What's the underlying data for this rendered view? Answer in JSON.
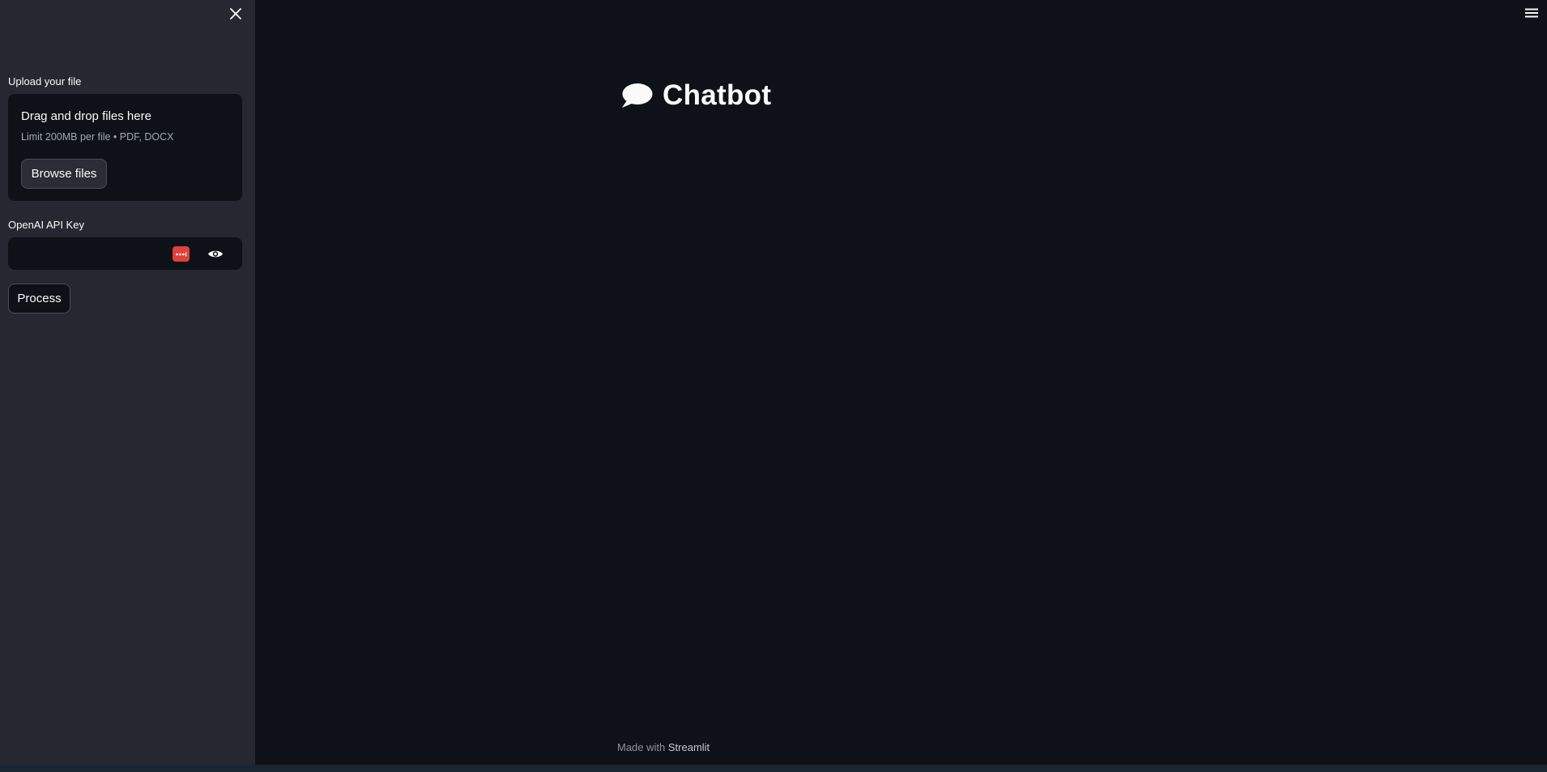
{
  "sidebar": {
    "close_icon": "close-icon",
    "upload_label": "Upload your file",
    "uploader": {
      "title": "Drag and drop files here",
      "hint": "Limit 200MB per file • PDF, DOCX",
      "browse_label": "Browse files"
    },
    "api_key": {
      "label": "OpenAI API Key",
      "value": "",
      "badge_icon": "password-manager-icon",
      "toggle_icon": "eye-icon"
    },
    "process_label": "Process"
  },
  "main": {
    "title": "Chatbot",
    "title_icon": "speech-bubble-icon",
    "menu_icon": "hamburger-menu-icon"
  },
  "footer": {
    "prefix": "Made with",
    "link": "Streamlit"
  },
  "colors": {
    "background": "#0e1117",
    "sidebar": "#262730",
    "text": "#fafafa",
    "badge": "#e0413b"
  }
}
